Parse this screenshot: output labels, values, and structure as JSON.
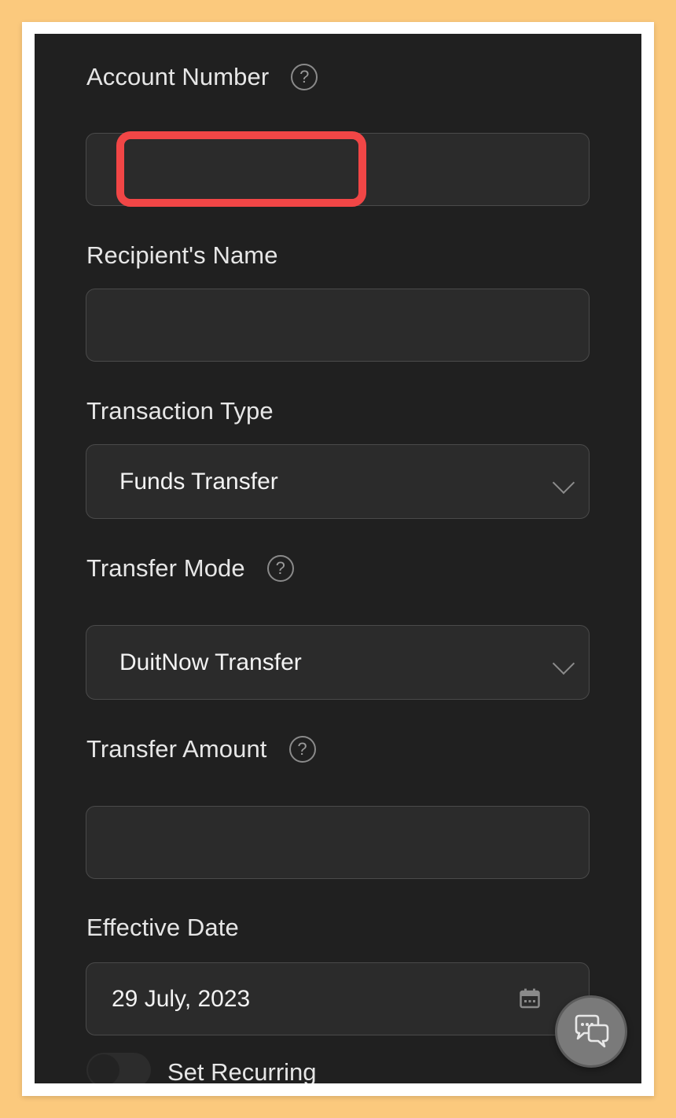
{
  "form": {
    "account_number": {
      "label": "Account Number",
      "value": ""
    },
    "recipient_name": {
      "label": "Recipient's Name",
      "value": ""
    },
    "transaction_type": {
      "label": "Transaction Type",
      "selected": "Funds Transfer"
    },
    "transfer_mode": {
      "label": "Transfer Mode",
      "selected": "DuitNow Transfer"
    },
    "transfer_amount": {
      "label": "Transfer Amount",
      "value": ""
    },
    "effective_date": {
      "label": "Effective Date",
      "value": "29 July,  2023"
    },
    "recurring": {
      "label": "Set Recurring",
      "enabled": false
    }
  },
  "icons": {
    "help": "help-circle-icon",
    "chevron": "chevron-down-icon",
    "calendar": "calendar-icon",
    "chat": "chat-bubbles-icon"
  },
  "colors": {
    "background": "#202020",
    "field_bg": "#2b2b2b",
    "highlight": "#f14646",
    "frame_outer": "#fbc97d"
  }
}
